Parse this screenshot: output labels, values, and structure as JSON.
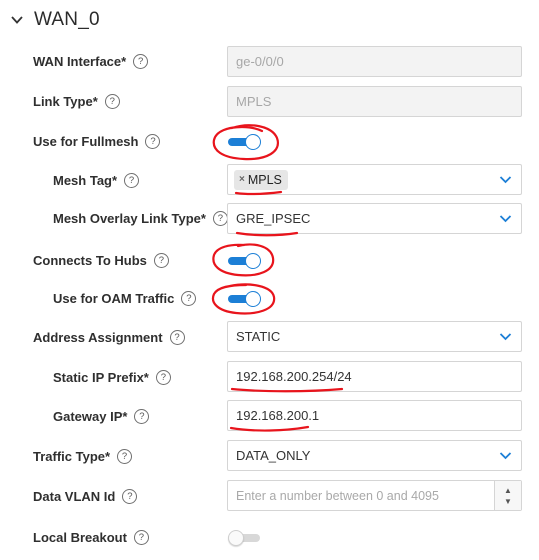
{
  "section": {
    "title": "WAN_0"
  },
  "fields": {
    "wan_interface": {
      "label": "WAN Interface*",
      "value": "ge-0/0/0"
    },
    "link_type": {
      "label": "Link Type*",
      "value": "MPLS"
    },
    "use_fullmesh": {
      "label": "Use for Fullmesh",
      "state": "on"
    },
    "mesh_tag": {
      "label": "Mesh Tag*",
      "chip": "MPLS",
      "chip_remove": "×"
    },
    "mesh_overlay_link_type": {
      "label": "Mesh Overlay Link Type*",
      "value": "GRE_IPSEC"
    },
    "connects_to_hubs": {
      "label": "Connects To Hubs",
      "state": "on"
    },
    "use_oam_traffic": {
      "label": "Use for OAM Traffic",
      "state": "on"
    },
    "address_assignment": {
      "label": "Address Assignment",
      "value": "STATIC"
    },
    "static_ip_prefix": {
      "label": "Static IP Prefix*",
      "value": "192.168.200.254/24"
    },
    "gateway_ip": {
      "label": "Gateway IP*",
      "value": "192.168.200.1"
    },
    "traffic_type": {
      "label": "Traffic Type*",
      "value": "DATA_ONLY"
    },
    "data_vlan_id": {
      "label": "Data VLAN Id",
      "placeholder": "Enter a number between 0 and 4095"
    },
    "local_breakout": {
      "label": "Local Breakout",
      "state": "off"
    }
  },
  "icons": {
    "help": "?",
    "chevron": "chevron-down-icon",
    "stepper_up": "▲",
    "stepper_down": "▼"
  },
  "colors": {
    "accent": "#1c7fd6",
    "annotation": "#e8141c",
    "disabled_bg": "#f3f3f3"
  }
}
